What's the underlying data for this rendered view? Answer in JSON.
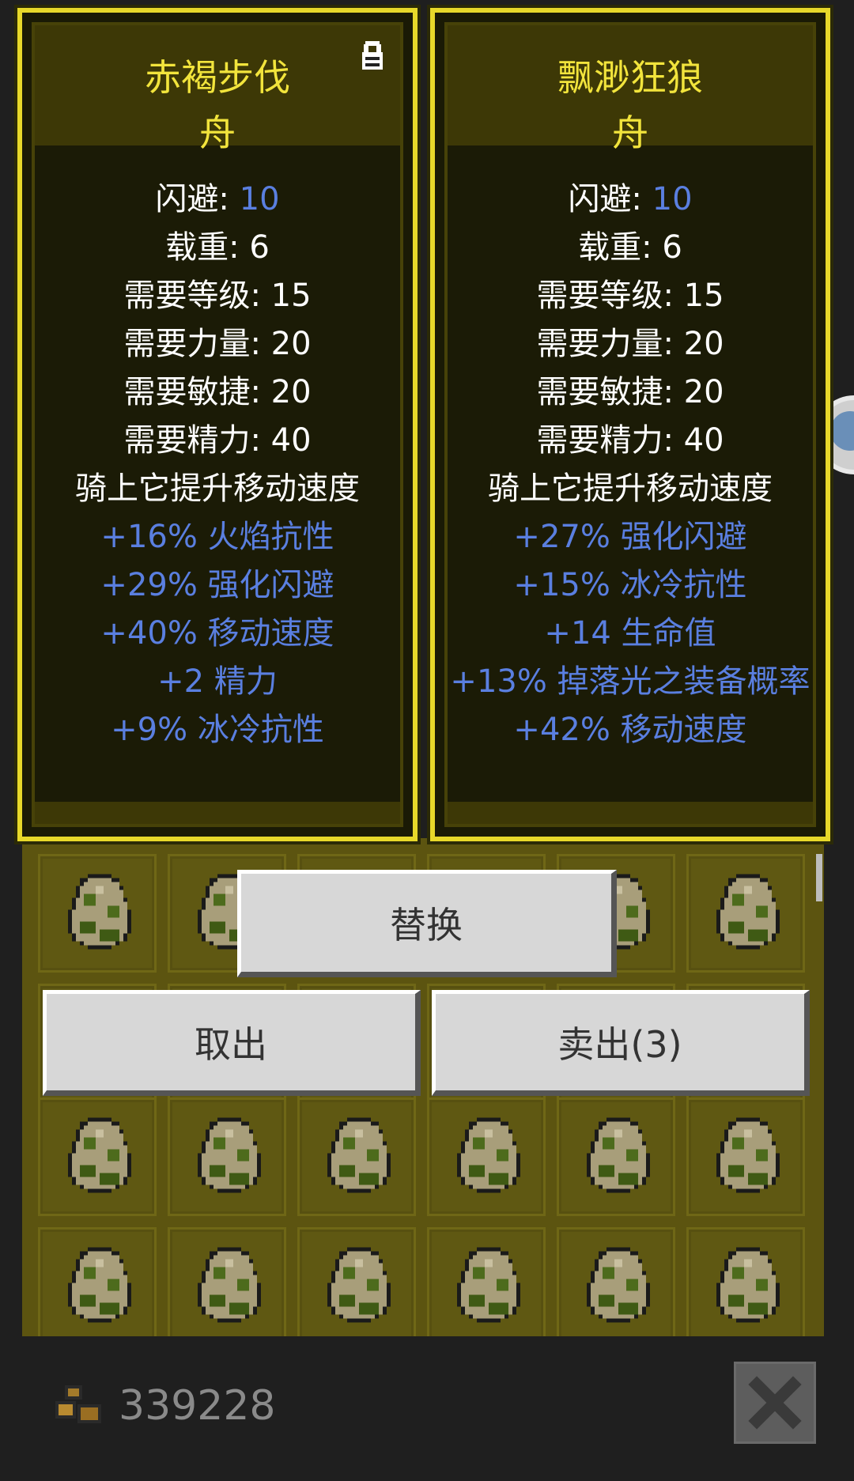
{
  "cards": [
    {
      "name": "赤褐步伐",
      "type": "舟",
      "locked": true,
      "stats": [
        {
          "label": "闪避: ",
          "value": "10",
          "style": "white-blue"
        },
        {
          "label": "载重: 6",
          "style": "white"
        },
        {
          "label": "需要等级: 15",
          "style": "white"
        },
        {
          "label": "需要力量: 20",
          "style": "white"
        },
        {
          "label": "需要敏捷: 20",
          "style": "white"
        },
        {
          "label": "需要精力: 40",
          "style": "white"
        },
        {
          "label": "骑上它提升移动速度",
          "style": "white"
        },
        {
          "label": "+16% 火焰抗性",
          "style": "blue"
        },
        {
          "label": "+29% 强化闪避",
          "style": "blue"
        },
        {
          "label": "+40% 移动速度",
          "style": "blue"
        },
        {
          "label": "+2 精力",
          "style": "blue"
        },
        {
          "label": "+9% 冰冷抗性",
          "style": "blue"
        }
      ]
    },
    {
      "name": "飘渺狂狼",
      "type": "舟",
      "locked": false,
      "stats": [
        {
          "label": "闪避: ",
          "value": "10",
          "style": "white-blue"
        },
        {
          "label": "载重: 6",
          "style": "white"
        },
        {
          "label": "需要等级: 15",
          "style": "white"
        },
        {
          "label": "需要力量: 20",
          "style": "white"
        },
        {
          "label": "需要敏捷: 20",
          "style": "white"
        },
        {
          "label": "需要精力: 40",
          "style": "white"
        },
        {
          "label": "骑上它提升移动速度",
          "style": "white"
        },
        {
          "label": "+27% 强化闪避",
          "style": "blue"
        },
        {
          "label": "+15% 冰冷抗性",
          "style": "blue"
        },
        {
          "label": "+14 生命值",
          "style": "blue"
        },
        {
          "label": "+13% 掉落光之装备概率",
          "style": "blue"
        },
        {
          "label": "+42% 移动速度",
          "style": "blue"
        }
      ]
    }
  ],
  "buttons": {
    "replace": "替换",
    "take_out": "取出",
    "sell": "卖出(3)"
  },
  "footer": {
    "gold_amount": "339228"
  },
  "icons": {
    "lock": "lock-icon",
    "egg": "egg-icon",
    "gold": "gold-coins-icon",
    "close": "close-icon"
  },
  "colors": {
    "title": "#f2e43c",
    "affix_blue": "#5a7fe0",
    "card_border": "#e7d82a"
  }
}
